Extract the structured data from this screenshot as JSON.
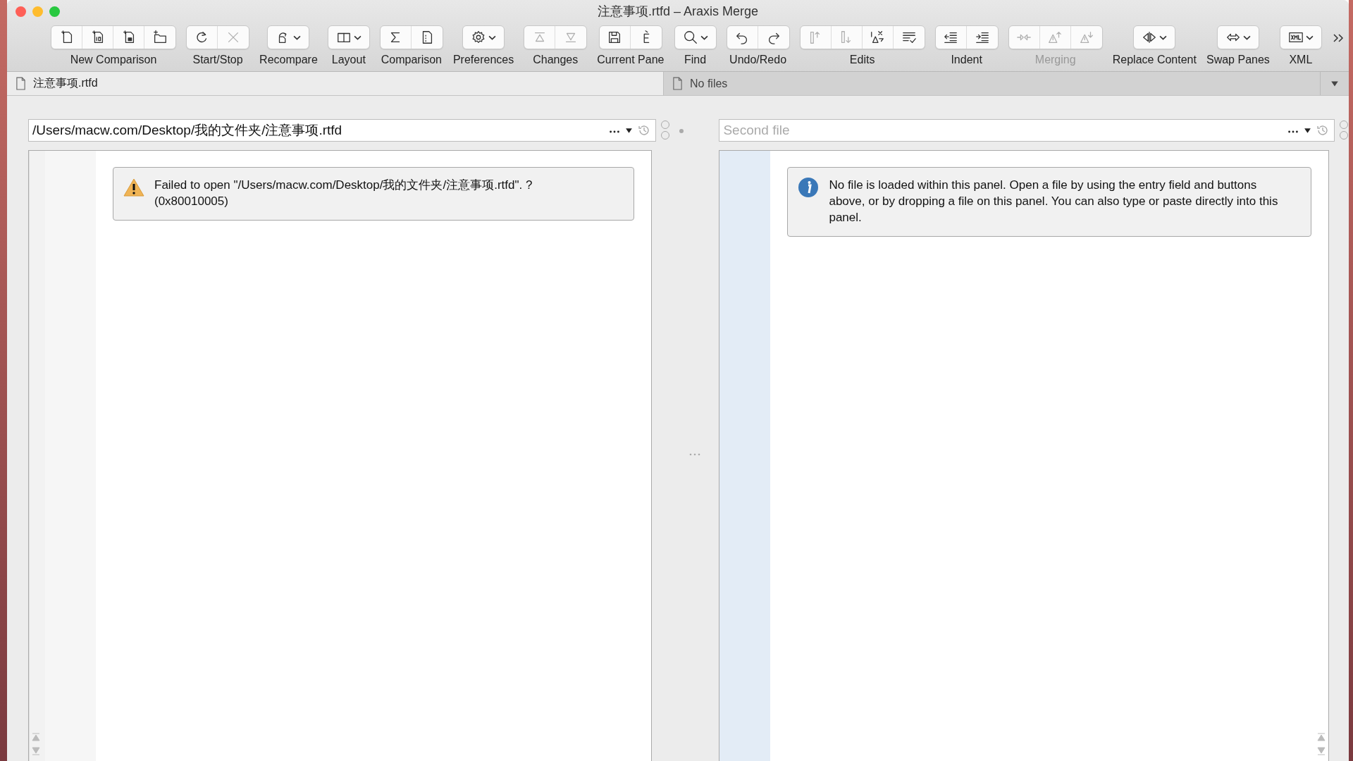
{
  "window": {
    "title": "注意事项.rtfd – Araxis Merge"
  },
  "toolbar": [
    {
      "label": "New Comparison",
      "disabled": false,
      "buttons": [
        {
          "kind": "new-file",
          "disabled": false,
          "menu": false
        },
        {
          "kind": "new-binary",
          "disabled": false,
          "menu": false
        },
        {
          "kind": "new-image",
          "disabled": false,
          "menu": false
        },
        {
          "kind": "new-folder",
          "disabled": false,
          "menu": false
        }
      ]
    },
    {
      "label": "Start/Stop",
      "disabled": false,
      "buttons": [
        {
          "kind": "refresh",
          "disabled": false,
          "menu": false
        },
        {
          "kind": "stop",
          "disabled": true,
          "menu": false
        }
      ]
    },
    {
      "label": "Recompare",
      "disabled": false,
      "buttons": [
        {
          "kind": "recompare",
          "disabled": false,
          "menu": true
        }
      ]
    },
    {
      "label": "Layout",
      "disabled": false,
      "buttons": [
        {
          "kind": "layout",
          "disabled": false,
          "menu": true
        }
      ]
    },
    {
      "label": "Comparison",
      "disabled": false,
      "buttons": [
        {
          "kind": "sigma",
          "disabled": false,
          "menu": false
        },
        {
          "kind": "document",
          "disabled": false,
          "menu": false
        }
      ]
    },
    {
      "label": "Preferences",
      "disabled": false,
      "buttons": [
        {
          "kind": "gear",
          "disabled": false,
          "menu": true
        }
      ]
    },
    {
      "label": "Changes",
      "disabled": false,
      "buttons": [
        {
          "kind": "prev",
          "disabled": true,
          "menu": false
        },
        {
          "kind": "next",
          "disabled": true,
          "menu": false
        }
      ]
    },
    {
      "label": "Current Pane",
      "disabled": false,
      "buttons": [
        {
          "kind": "save",
          "disabled": false,
          "menu": false
        },
        {
          "kind": "edit",
          "disabled": false,
          "menu": false
        }
      ]
    },
    {
      "label": "Find",
      "disabled": false,
      "buttons": [
        {
          "kind": "search",
          "disabled": false,
          "menu": true
        }
      ]
    },
    {
      "label": "Undo/Redo",
      "disabled": false,
      "buttons": [
        {
          "kind": "undo",
          "disabled": false,
          "menu": false
        },
        {
          "kind": "redo",
          "disabled": false,
          "menu": false
        }
      ]
    },
    {
      "label": "Edits",
      "disabled": false,
      "buttons": [
        {
          "kind": "bar-up",
          "disabled": true,
          "menu": false
        },
        {
          "kind": "bar-down",
          "disabled": true,
          "menu": false
        },
        {
          "kind": "warning-x",
          "disabled": false,
          "menu": false
        },
        {
          "kind": "checklist",
          "disabled": false,
          "menu": false
        }
      ]
    },
    {
      "label": "Indent",
      "disabled": false,
      "buttons": [
        {
          "kind": "outdent",
          "disabled": false,
          "menu": false
        },
        {
          "kind": "indent",
          "disabled": false,
          "menu": false
        }
      ]
    },
    {
      "label": "Merging",
      "disabled": true,
      "buttons": [
        {
          "kind": "merge",
          "disabled": true,
          "menu": false
        },
        {
          "kind": "warning-up",
          "disabled": true,
          "menu": false
        },
        {
          "kind": "warning-down",
          "disabled": true,
          "menu": false
        }
      ]
    },
    {
      "label": "Replace Content",
      "disabled": false,
      "buttons": [
        {
          "kind": "replace",
          "disabled": false,
          "menu": true
        }
      ]
    },
    {
      "label": "Swap Panes",
      "disabled": false,
      "buttons": [
        {
          "kind": "swap",
          "disabled": false,
          "menu": true
        }
      ]
    },
    {
      "label": "XML",
      "disabled": false,
      "buttons": [
        {
          "kind": "xml",
          "disabled": false,
          "menu": true
        }
      ]
    }
  ],
  "tabs": [
    {
      "label": "注意事项.rtfd",
      "selected": true
    },
    {
      "label": "No files",
      "selected": false
    }
  ],
  "panes": [
    {
      "value": "/Users/macw.com/Desktop/我的文件夹/注意事项.rtfd",
      "loaded": true,
      "message": {
        "kind": "warning",
        "text": "Failed to open \"/Users/macw.com/Desktop/我的文件夹/注意事项.rtfd\". ?\n(0x80010005)"
      }
    },
    {
      "placeholder": "Second file",
      "loaded": false,
      "message": {
        "kind": "info",
        "text": "No file is loaded within this panel. Open a file by using the entry field and buttons above, or by dropping a file on this panel. You can also type or paste directly into this panel."
      }
    }
  ]
}
